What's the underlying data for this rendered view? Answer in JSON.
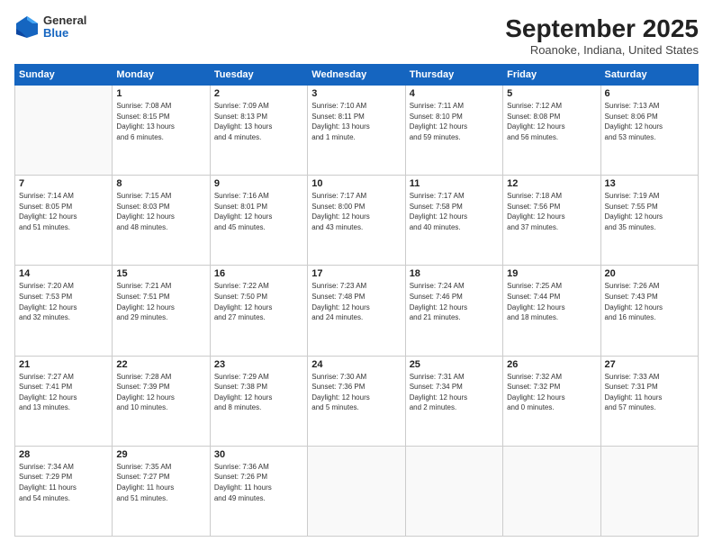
{
  "header": {
    "logo_general": "General",
    "logo_blue": "Blue",
    "month_title": "September 2025",
    "location": "Roanoke, Indiana, United States"
  },
  "days_of_week": [
    "Sunday",
    "Monday",
    "Tuesday",
    "Wednesday",
    "Thursday",
    "Friday",
    "Saturday"
  ],
  "weeks": [
    [
      {
        "day": "",
        "info": ""
      },
      {
        "day": "1",
        "info": "Sunrise: 7:08 AM\nSunset: 8:15 PM\nDaylight: 13 hours\nand 6 minutes."
      },
      {
        "day": "2",
        "info": "Sunrise: 7:09 AM\nSunset: 8:13 PM\nDaylight: 13 hours\nand 4 minutes."
      },
      {
        "day": "3",
        "info": "Sunrise: 7:10 AM\nSunset: 8:11 PM\nDaylight: 13 hours\nand 1 minute."
      },
      {
        "day": "4",
        "info": "Sunrise: 7:11 AM\nSunset: 8:10 PM\nDaylight: 12 hours\nand 59 minutes."
      },
      {
        "day": "5",
        "info": "Sunrise: 7:12 AM\nSunset: 8:08 PM\nDaylight: 12 hours\nand 56 minutes."
      },
      {
        "day": "6",
        "info": "Sunrise: 7:13 AM\nSunset: 8:06 PM\nDaylight: 12 hours\nand 53 minutes."
      }
    ],
    [
      {
        "day": "7",
        "info": "Sunrise: 7:14 AM\nSunset: 8:05 PM\nDaylight: 12 hours\nand 51 minutes."
      },
      {
        "day": "8",
        "info": "Sunrise: 7:15 AM\nSunset: 8:03 PM\nDaylight: 12 hours\nand 48 minutes."
      },
      {
        "day": "9",
        "info": "Sunrise: 7:16 AM\nSunset: 8:01 PM\nDaylight: 12 hours\nand 45 minutes."
      },
      {
        "day": "10",
        "info": "Sunrise: 7:17 AM\nSunset: 8:00 PM\nDaylight: 12 hours\nand 43 minutes."
      },
      {
        "day": "11",
        "info": "Sunrise: 7:17 AM\nSunset: 7:58 PM\nDaylight: 12 hours\nand 40 minutes."
      },
      {
        "day": "12",
        "info": "Sunrise: 7:18 AM\nSunset: 7:56 PM\nDaylight: 12 hours\nand 37 minutes."
      },
      {
        "day": "13",
        "info": "Sunrise: 7:19 AM\nSunset: 7:55 PM\nDaylight: 12 hours\nand 35 minutes."
      }
    ],
    [
      {
        "day": "14",
        "info": "Sunrise: 7:20 AM\nSunset: 7:53 PM\nDaylight: 12 hours\nand 32 minutes."
      },
      {
        "day": "15",
        "info": "Sunrise: 7:21 AM\nSunset: 7:51 PM\nDaylight: 12 hours\nand 29 minutes."
      },
      {
        "day": "16",
        "info": "Sunrise: 7:22 AM\nSunset: 7:50 PM\nDaylight: 12 hours\nand 27 minutes."
      },
      {
        "day": "17",
        "info": "Sunrise: 7:23 AM\nSunset: 7:48 PM\nDaylight: 12 hours\nand 24 minutes."
      },
      {
        "day": "18",
        "info": "Sunrise: 7:24 AM\nSunset: 7:46 PM\nDaylight: 12 hours\nand 21 minutes."
      },
      {
        "day": "19",
        "info": "Sunrise: 7:25 AM\nSunset: 7:44 PM\nDaylight: 12 hours\nand 18 minutes."
      },
      {
        "day": "20",
        "info": "Sunrise: 7:26 AM\nSunset: 7:43 PM\nDaylight: 12 hours\nand 16 minutes."
      }
    ],
    [
      {
        "day": "21",
        "info": "Sunrise: 7:27 AM\nSunset: 7:41 PM\nDaylight: 12 hours\nand 13 minutes."
      },
      {
        "day": "22",
        "info": "Sunrise: 7:28 AM\nSunset: 7:39 PM\nDaylight: 12 hours\nand 10 minutes."
      },
      {
        "day": "23",
        "info": "Sunrise: 7:29 AM\nSunset: 7:38 PM\nDaylight: 12 hours\nand 8 minutes."
      },
      {
        "day": "24",
        "info": "Sunrise: 7:30 AM\nSunset: 7:36 PM\nDaylight: 12 hours\nand 5 minutes."
      },
      {
        "day": "25",
        "info": "Sunrise: 7:31 AM\nSunset: 7:34 PM\nDaylight: 12 hours\nand 2 minutes."
      },
      {
        "day": "26",
        "info": "Sunrise: 7:32 AM\nSunset: 7:32 PM\nDaylight: 12 hours\nand 0 minutes."
      },
      {
        "day": "27",
        "info": "Sunrise: 7:33 AM\nSunset: 7:31 PM\nDaylight: 11 hours\nand 57 minutes."
      }
    ],
    [
      {
        "day": "28",
        "info": "Sunrise: 7:34 AM\nSunset: 7:29 PM\nDaylight: 11 hours\nand 54 minutes."
      },
      {
        "day": "29",
        "info": "Sunrise: 7:35 AM\nSunset: 7:27 PM\nDaylight: 11 hours\nand 51 minutes."
      },
      {
        "day": "30",
        "info": "Sunrise: 7:36 AM\nSunset: 7:26 PM\nDaylight: 11 hours\nand 49 minutes."
      },
      {
        "day": "",
        "info": ""
      },
      {
        "day": "",
        "info": ""
      },
      {
        "day": "",
        "info": ""
      },
      {
        "day": "",
        "info": ""
      }
    ]
  ]
}
